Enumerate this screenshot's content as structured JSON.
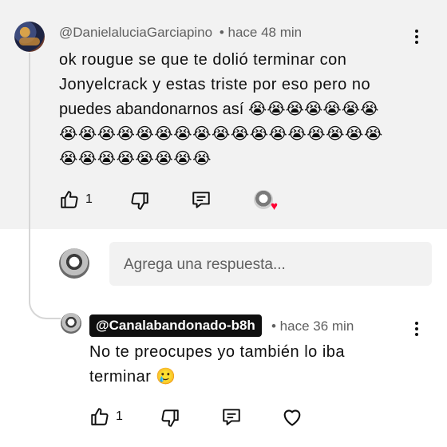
{
  "comment": {
    "author": "@DanielaluciaGarciapino",
    "time": "• hace 48 min",
    "text_line1": "ok rougue se que te dolió terminar con",
    "text_line2": "Jonyelcrack y estas triste por eso pero no",
    "text_line3": "puedes abandonarnos así",
    "emoji_row1": "😭😭😭😭😭😭😭",
    "emoji_row2": "😭😭😭😭😭😭😭😭😭😭😭😭😭😭😭😭😭",
    "emoji_row3": "😭😭😭😭😭😭😭😭",
    "like_count": "1"
  },
  "reply_input": {
    "placeholder": "Agrega una respuesta..."
  },
  "reply": {
    "author": "@Canalabandonado-b8h",
    "time": "• hace 36 min",
    "text_line1": "No te preocupes yo también lo iba",
    "text_line2": "terminar 🥲",
    "like_count": "1"
  },
  "colors": {
    "comment_bg": "#f2f2f2",
    "heart": "#ff0033",
    "creator_badge_bg": "#0f0f0f"
  },
  "icons": [
    "thumbs-up-icon",
    "thumbs-down-icon",
    "reply-icon",
    "heart-icon",
    "more-vert-icon",
    "creator-heart-icon"
  ]
}
